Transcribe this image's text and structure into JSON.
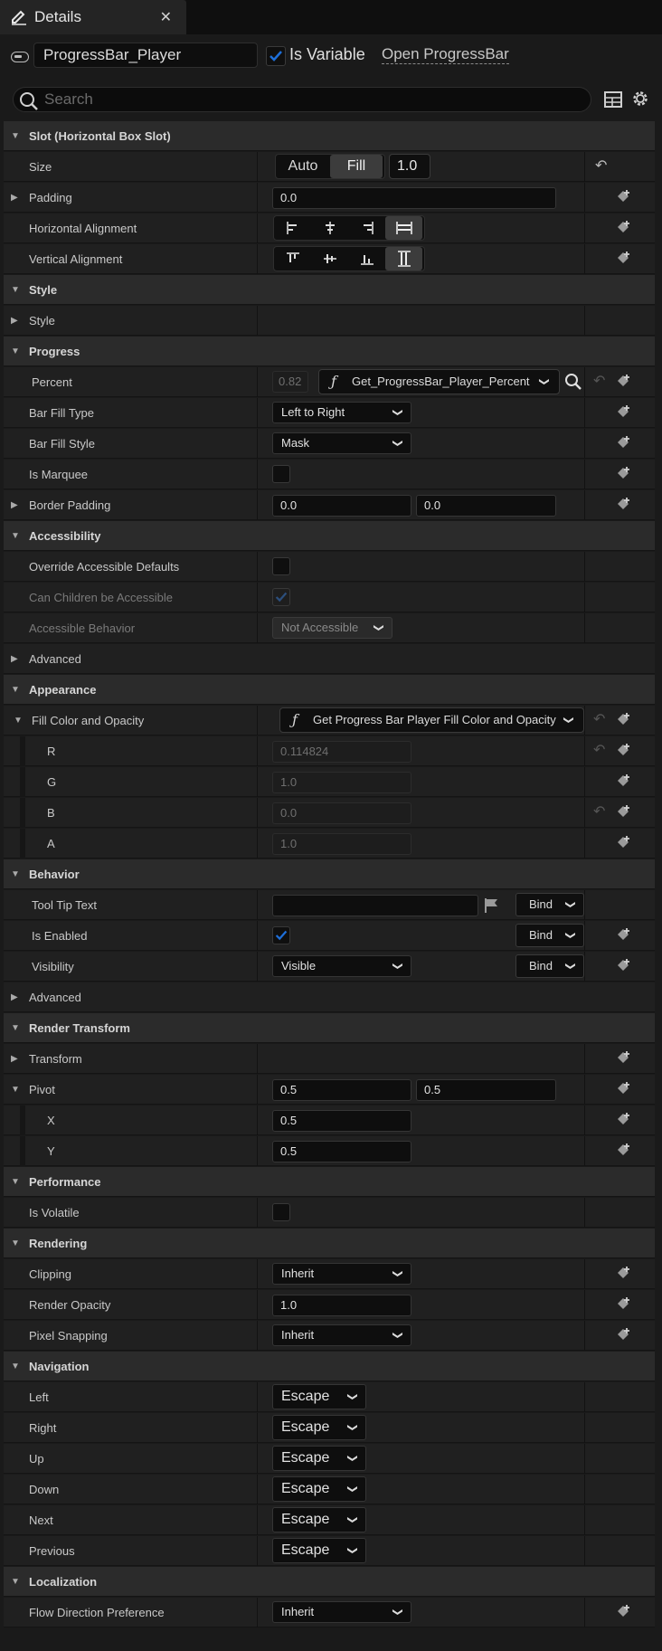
{
  "tab": {
    "title": "Details",
    "close": "✕"
  },
  "header": {
    "widget_name": "ProgressBar_Player",
    "is_variable_label": "Is Variable",
    "is_variable_checked": true,
    "open_link": "Open ProgressBar"
  },
  "search": {
    "placeholder": "Search"
  },
  "slot": {
    "title": "Slot (Horizontal Box Slot)",
    "size_label": "Size",
    "size_auto": "Auto",
    "size_fill": "Fill",
    "size_value": "1.0",
    "padding_label": "Padding",
    "padding_value": "0.0",
    "halign_label": "Horizontal Alignment",
    "valign_label": "Vertical Alignment"
  },
  "style": {
    "title": "Style",
    "style_label": "Style"
  },
  "progress": {
    "title": "Progress",
    "percent_label": "Percent",
    "percent_value": "0.82",
    "percent_binding": "Get_ProgressBar_Player_Percent",
    "fill_type_label": "Bar Fill Type",
    "fill_type_value": "Left to Right",
    "fill_style_label": "Bar Fill Style",
    "fill_style_value": "Mask",
    "marquee_label": "Is Marquee",
    "border_padding_label": "Border Padding",
    "border_padding_x": "0.0",
    "border_padding_y": "0.0"
  },
  "accessibility": {
    "title": "Accessibility",
    "override_label": "Override Accessible Defaults",
    "children_label": "Can Children be Accessible",
    "behavior_label": "Accessible Behavior",
    "behavior_value": "Not Accessible",
    "advanced_label": "Advanced"
  },
  "appearance": {
    "title": "Appearance",
    "fill_label": "Fill Color and Opacity",
    "fill_binding": "Get Progress Bar Player Fill Color and Opacity",
    "r_label": "R",
    "r_value": "0.114824",
    "g_label": "G",
    "g_value": "1.0",
    "b_label": "B",
    "b_value": "0.0",
    "a_label": "A",
    "a_value": "1.0"
  },
  "behavior": {
    "title": "Behavior",
    "tooltip_label": "Tool Tip Text",
    "tooltip_value": "",
    "enabled_label": "Is Enabled",
    "visibility_label": "Visibility",
    "visibility_value": "Visible",
    "bind_label": "Bind",
    "advanced_label": "Advanced"
  },
  "render_transform": {
    "title": "Render Transform",
    "transform_label": "Transform",
    "pivot_label": "Pivot",
    "pivot_x": "0.5",
    "pivot_y": "0.5",
    "x_label": "X",
    "x_value": "0.5",
    "y_label": "Y",
    "y_value": "0.5"
  },
  "performance": {
    "title": "Performance",
    "volatile_label": "Is Volatile"
  },
  "rendering": {
    "title": "Rendering",
    "clipping_label": "Clipping",
    "clipping_value": "Inherit",
    "opacity_label": "Render Opacity",
    "opacity_value": "1.0",
    "snapping_label": "Pixel Snapping",
    "snapping_value": "Inherit"
  },
  "navigation": {
    "title": "Navigation",
    "left_label": "Left",
    "right_label": "Right",
    "up_label": "Up",
    "down_label": "Down",
    "next_label": "Next",
    "previous_label": "Previous",
    "rule_value": "Escape"
  },
  "localization": {
    "title": "Localization",
    "flow_label": "Flow Direction Preference",
    "flow_value": "Inherit"
  },
  "colors": {
    "accent": "#1e6fd9",
    "panel": "#202020",
    "category": "#2b2b2b"
  }
}
